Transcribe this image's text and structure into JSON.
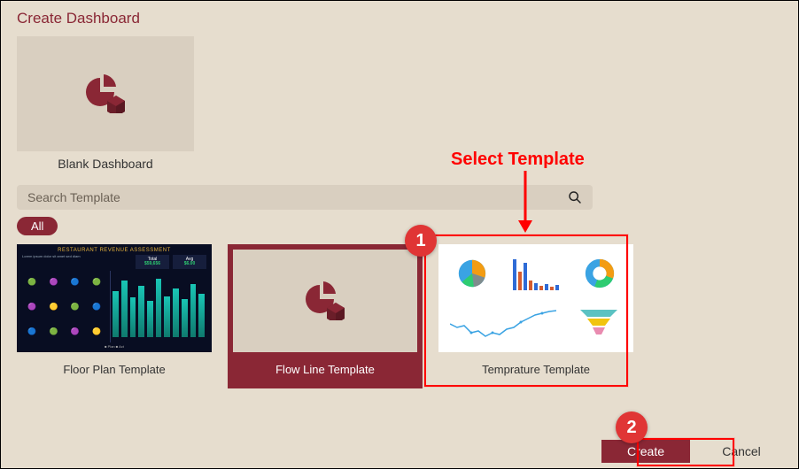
{
  "title": "Create Dashboard",
  "blank": {
    "label": "Blank Dashboard"
  },
  "search": {
    "placeholder": "Search Template"
  },
  "filter": {
    "all": "All"
  },
  "templates": [
    {
      "label": "Floor Plan Template",
      "selected": false,
      "kind": "floorplan",
      "floorplan_title": "RESTAURANT REVENUE ASSESSMENT",
      "box1_label": "Total",
      "box1_value": "$59,656",
      "box2_label": "Avg",
      "box2_value": "$6.00"
    },
    {
      "label": "Flow Line Template",
      "selected": true,
      "kind": "icon"
    },
    {
      "label": "Temprature Template",
      "selected": false,
      "kind": "temperature"
    }
  ],
  "buttons": {
    "create": "Create",
    "cancel": "Cancel"
  },
  "annotations": {
    "select_template": "Select Template",
    "step1": "1",
    "step2": "2"
  }
}
